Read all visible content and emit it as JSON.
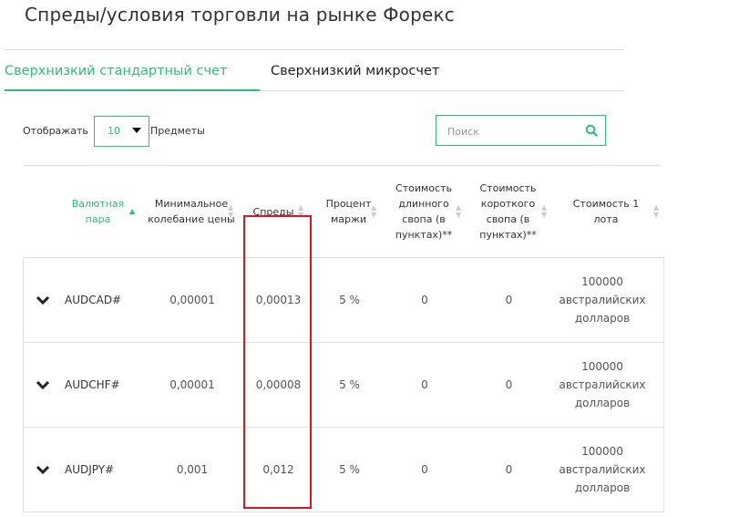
{
  "page": {
    "title": "Спреды/условия торговли на рынке Форекс"
  },
  "tabs": [
    {
      "label": "Сверхнизкий стандартный счет",
      "active": true
    },
    {
      "label": "Сверхнизкий микросчет",
      "active": false
    }
  ],
  "controls": {
    "show_label": "Отображать",
    "page_size": "10",
    "items_label": "Предметы",
    "search_placeholder": "Поиск"
  },
  "table": {
    "columns": [
      "Валютная пара",
      "Минимальное колебание цены",
      "Спреды",
      "Процент маржи",
      "Стоимость длинного свопа (в пунктах)**",
      "Стоимость короткого свопа (в пунктах)**",
      "Стоимость 1 лота"
    ],
    "rows": [
      {
        "pair": "AUDCAD#",
        "min_tick": "0,00001",
        "spread": "0,00013",
        "margin": "5 %",
        "swap_long": "0",
        "swap_short": "0",
        "lot": "100000 австралийских долларов"
      },
      {
        "pair": "AUDCHF#",
        "min_tick": "0,00001",
        "spread": "0,00008",
        "margin": "5 %",
        "swap_long": "0",
        "swap_short": "0",
        "lot": "100000 австралийских долларов"
      },
      {
        "pair": "AUDJPY#",
        "min_tick": "0,001",
        "spread": "0,012",
        "margin": "5 %",
        "swap_long": "0",
        "swap_short": "0",
        "lot": "100000 австралийских долларов"
      }
    ]
  },
  "colors": {
    "accent": "#2bbf7a",
    "highlight": "#e0131f"
  }
}
